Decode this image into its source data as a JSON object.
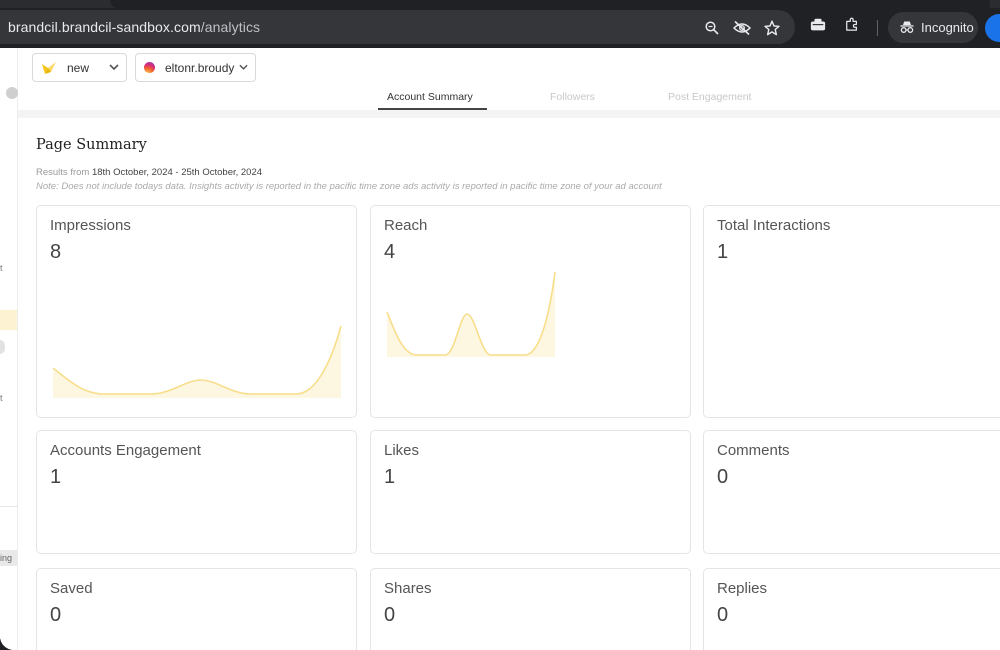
{
  "browser": {
    "url_domain": "brandcil.brandcil-sandbox.com",
    "url_path": "/analytics",
    "incognito_label": "Incognito",
    "accent": "#1a73e8"
  },
  "sidebar": {
    "fragments": [
      "t",
      "t",
      "ing"
    ]
  },
  "toolbar": {
    "brand_select": "new",
    "account_select": "eltonr.broudy"
  },
  "tabs": [
    {
      "label": "Account Summary",
      "active": true
    },
    {
      "label": "Followers",
      "active": false
    },
    {
      "label": "Post Engagement",
      "active": false
    }
  ],
  "summary": {
    "title": "Page Summary",
    "results_prefix": "Results from",
    "date_range": "18th October, 2024 - 25th October, 2024",
    "note": "Note: Does not include todays data. Insights activity is reported in the pacific time zone ads activity is reported in pacific time zone of your ad account"
  },
  "cards": [
    {
      "title": "Impressions",
      "value": "8"
    },
    {
      "title": "Reach",
      "value": "4"
    },
    {
      "title": "Total Interactions",
      "value": "1"
    },
    {
      "title": "Accounts Engagement",
      "value": "1"
    },
    {
      "title": "Likes",
      "value": "1"
    },
    {
      "title": "Comments",
      "value": "0"
    },
    {
      "title": "Saved",
      "value": "0"
    },
    {
      "title": "Shares",
      "value": "0"
    },
    {
      "title": "Replies",
      "value": "0"
    }
  ],
  "colors": {
    "spark_line": "#f8de8a",
    "spark_fill": "#fdf6dc"
  }
}
